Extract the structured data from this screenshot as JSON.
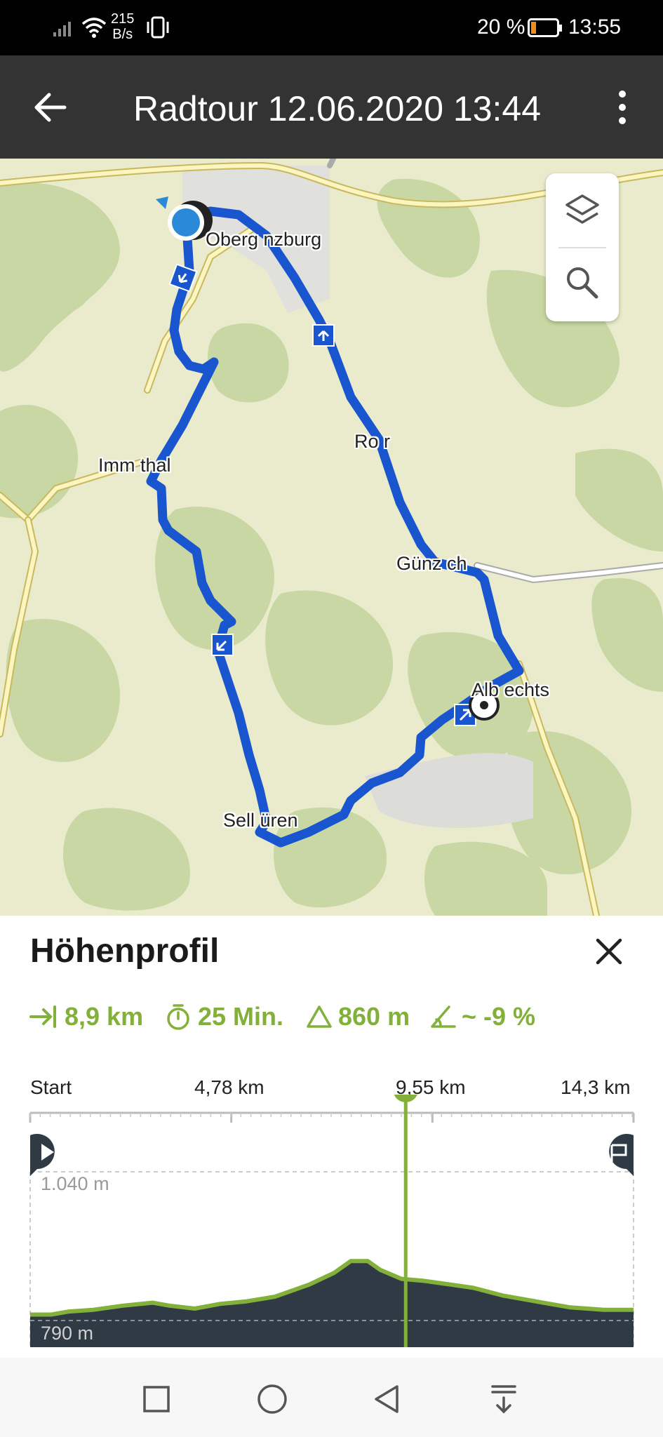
{
  "status_bar": {
    "net_speed_value": "215",
    "net_speed_unit": "B/s",
    "battery_percent": "20 %",
    "battery_level": 0.2,
    "time": "13:55",
    "icons": [
      "signal-icon",
      "wifi-icon",
      "vibrate-icon",
      "battery-icon"
    ]
  },
  "app_bar": {
    "title": "Radtour 12.06.2020 13:44",
    "icons": [
      "back-arrow-icon",
      "more-vert-icon"
    ]
  },
  "map": {
    "places": [
      "Obergünzburg",
      "Immenthal",
      "Ronsberg",
      "Günzach",
      "Albrechts",
      "Sellthüren"
    ],
    "label_oberguenzburg": "Oberg nzburg",
    "label_immenthal": "Imm thal",
    "label_ronsberg": "Ro r",
    "label_guenzach": "Günz ch",
    "label_albrechts": "Alb echts",
    "label_sellthueren": "Sell üren",
    "route_color": "#1a55d0",
    "tools": [
      "layers-icon",
      "search-icon"
    ]
  },
  "panel": {
    "title": "Höhenprofil",
    "stats": {
      "distance": "8,9 km",
      "duration": "25 Min.",
      "ascent": "860 m",
      "gradient": "~ -9 %"
    },
    "axis_labels": {
      "start": "Start",
      "t1": "4,78 km",
      "t2": "9,55 km",
      "t3": "14,3 km"
    },
    "cursor_position_km": 8.9,
    "accent_color": "#82b03a"
  },
  "chart_data": {
    "type": "area",
    "x_unit": "km",
    "y_unit": "m",
    "xlim": [
      0,
      14.3
    ],
    "ylim": [
      790,
      1040
    ],
    "x_ticks": [
      "Start",
      "4,78 km",
      "9,55 km",
      "14,3 km"
    ],
    "y_max_label": "1.040 m",
    "y_min_label": "790 m",
    "x": [
      0,
      0.5,
      0.9,
      1.5,
      2.2,
      2.9,
      3.3,
      3.9,
      4.5,
      5.1,
      5.8,
      6.6,
      7.2,
      7.6,
      8.0,
      8.3,
      8.8,
      9.3,
      9.8,
      10.5,
      11.2,
      12.0,
      12.8,
      13.6,
      14.3
    ],
    "y": [
      800,
      800,
      805,
      808,
      815,
      820,
      815,
      810,
      818,
      822,
      830,
      850,
      870,
      890,
      890,
      875,
      860,
      857,
      852,
      845,
      832,
      822,
      812,
      808,
      808
    ]
  },
  "nav_bar": {
    "icons": [
      "recent-apps-icon",
      "home-icon",
      "back-triangle-icon",
      "notification-pull-icon"
    ]
  }
}
